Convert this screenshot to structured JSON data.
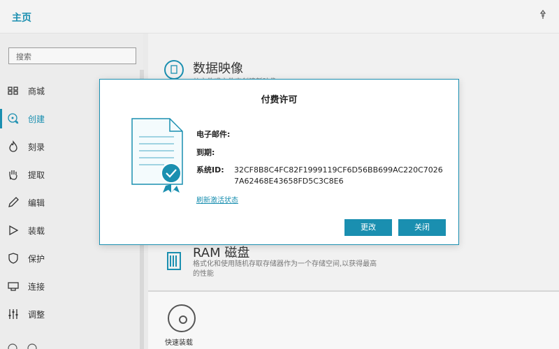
{
  "titlebar": {
    "title": "主页",
    "pin_icon": "pin-icon"
  },
  "sidebar": {
    "search_placeholder": "搜索",
    "items": [
      {
        "label": "商城",
        "icon": "grid-icon"
      },
      {
        "label": "创建",
        "icon": "create-icon",
        "active": true
      },
      {
        "label": "刻录",
        "icon": "burn-icon"
      },
      {
        "label": "提取",
        "icon": "hand-icon"
      },
      {
        "label": "编辑",
        "icon": "pencil-icon"
      },
      {
        "label": "装载",
        "icon": "play-icon"
      },
      {
        "label": "保护",
        "icon": "shield-icon"
      },
      {
        "label": "连接",
        "icon": "connect-icon"
      },
      {
        "label": "调整",
        "icon": "sliders-icon"
      }
    ]
  },
  "main": {
    "data_image": {
      "title": "数据映像",
      "desc": "从文件或文件夹创建新映像"
    },
    "ram_disk": {
      "title": "RAM 磁盘",
      "desc": "格式化和使用随机存取存储器作为一个存储空间,以获得最高的性能"
    },
    "quick_mount": {
      "label": "快速装载"
    }
  },
  "dialog": {
    "title": "付费许可",
    "email_label": "电子邮件:",
    "expiry_label": "到期:",
    "system_id_label": "系统ID:",
    "system_id_value": "32CF8B8C4FC82F1999119CF6D56BB699AC220C70267A62468E43658FD5C3C8E6",
    "refresh_link": "刷新激活状态",
    "change_button": "更改",
    "close_button": "关闭"
  },
  "colors": {
    "accent": "#1a8fb0"
  }
}
